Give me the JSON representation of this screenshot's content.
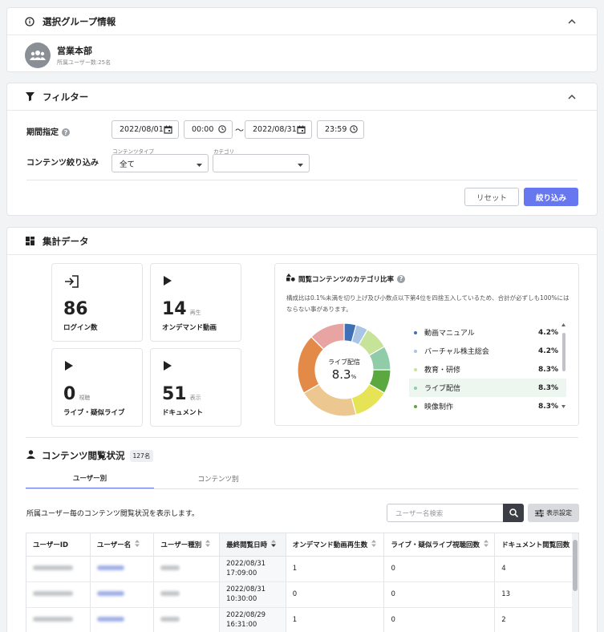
{
  "group_section": {
    "title": "選択グループ情報",
    "group_name": "営業本部",
    "member_count": "所属ユーザー数:25名"
  },
  "filter_section": {
    "title": "フィルター",
    "period_label": "期間指定",
    "start_date": "2022/08/01",
    "start_time": "00:00",
    "separator": "〜",
    "end_date": "2022/08/31",
    "end_time": "23:59",
    "content_filter_label": "コンテンツ絞り込み",
    "content_type_label": "コンテンツタイプ",
    "content_type_value": "全て",
    "category_label": "カテゴリ",
    "category_value": "",
    "reset_label": "リセット",
    "apply_label": "絞り込み"
  },
  "stats_section": {
    "title": "集計データ",
    "cards": [
      {
        "value": "86",
        "unit": "",
        "label": "ログイン数",
        "icon": "login-icon"
      },
      {
        "value": "14",
        "unit": "再生",
        "label": "オンデマンド動画",
        "icon": "play-icon"
      },
      {
        "value": "0",
        "unit": "視聴",
        "label": "ライブ・疑似ライブ",
        "icon": "play-icon"
      },
      {
        "value": "51",
        "unit": "表示",
        "label": "ドキュメント",
        "icon": "play-icon"
      }
    ]
  },
  "category_ratio": {
    "title": "閲覧コンテンツのカテゴリ比率",
    "note": "構成比は0.1%未満を切り上げ及び小数点以下第4位を四捨五入しているため、合計が必ずしも100%にはならない事があります。",
    "center_label": "ライブ配信",
    "center_value": "8.3",
    "center_unit": "%",
    "legend": [
      {
        "name": "動画マニュアル",
        "pct": "4.2%",
        "color": "#3f6fb5"
      },
      {
        "name": "バーチャル株主総会",
        "pct": "4.2%",
        "color": "#a9c4e4"
      },
      {
        "name": "教育・研修",
        "pct": "8.3%",
        "color": "#c7e39a"
      },
      {
        "name": "ライブ配信",
        "pct": "8.3%",
        "color": "#8fcca7"
      },
      {
        "name": "映像制作",
        "pct": "8.3%",
        "color": "#5aa83f"
      }
    ]
  },
  "chart_data": {
    "type": "pie",
    "categories": [
      "動画マニュアル",
      "バーチャル株主総会",
      "教育・研修",
      "ライブ配信",
      "映像制作",
      "",
      "",
      "",
      ""
    ],
    "values": [
      4.2,
      4.2,
      8.3,
      8.3,
      8.3,
      12.5,
      20.8,
      20.8,
      12.5
    ],
    "colors": [
      "#3f6fb5",
      "#a9c4e4",
      "#c7e39a",
      "#8fcca7",
      "#5aa83f",
      "#e6e357",
      "#ecc890",
      "#e38a48",
      "#e8a3a3"
    ]
  },
  "usage_section": {
    "title": "コンテンツ閲覧状況",
    "count_badge": "127名",
    "tabs": [
      "ユーザー別",
      "コンテンツ別"
    ],
    "description": "所属ユーザー毎のコンテンツ閲覧状況を表示します。",
    "search_placeholder": "ユーザー名検索",
    "display_settings_label": "表示設定",
    "columns": [
      "ユーザーID",
      "ユーザー名",
      "ユーザー種別",
      "最終閲覧日時",
      "オンデマンド動画再生数",
      "ライブ・疑似ライブ視聴回数",
      "ドキュメント閲覧回数"
    ],
    "rows": [
      {
        "last_view_date": "2022/08/31",
        "last_view_time": "17:09:00",
        "ondemand": "1",
        "live": "0",
        "document": "4"
      },
      {
        "last_view_date": "2022/08/31",
        "last_view_time": "10:30:00",
        "ondemand": "0",
        "live": "0",
        "document": "13"
      },
      {
        "last_view_date": "2022/08/29",
        "last_view_time": "16:31:00",
        "ondemand": "1",
        "live": "0",
        "document": "2"
      }
    ]
  }
}
